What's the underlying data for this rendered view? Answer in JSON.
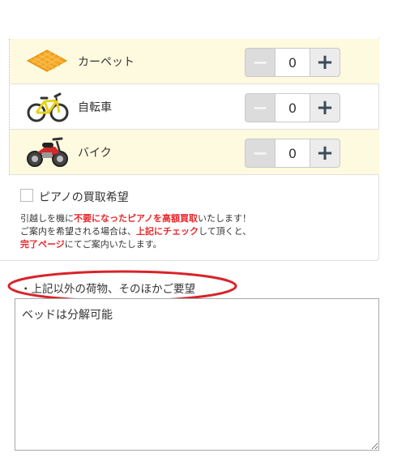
{
  "items": [
    {
      "label": "カーペット",
      "value": "0",
      "icon": "carpet-icon"
    },
    {
      "label": "自転車",
      "value": "0",
      "icon": "bicycle-icon"
    },
    {
      "label": "バイク",
      "value": "0",
      "icon": "motorbike-icon"
    }
  ],
  "stepper": {
    "minus": "−",
    "plus": "+"
  },
  "piano": {
    "label": "ピアノの買取希望",
    "checked": false,
    "note_line1_pre": "引越しを機に",
    "note_line1_red": "不要になったピアノを高額買取",
    "note_line1_post": "いたします！",
    "note_line2_pre": "ご案内を希望される場合は、",
    "note_line2_red": "上記にチェック",
    "note_line2_post": "して頂くと、",
    "note_line3_red": "完了ページ",
    "note_line3_post": "にてご案内いたします。"
  },
  "other": {
    "label": "・上記以外の荷物、そのほかご要望",
    "value": "ベッドは分解可能"
  },
  "colors": {
    "row_highlight": "#fdfadf",
    "accent_red": "#e8282d",
    "annotation_ellipse": "#d8232a",
    "carpet": "#f5a623"
  }
}
